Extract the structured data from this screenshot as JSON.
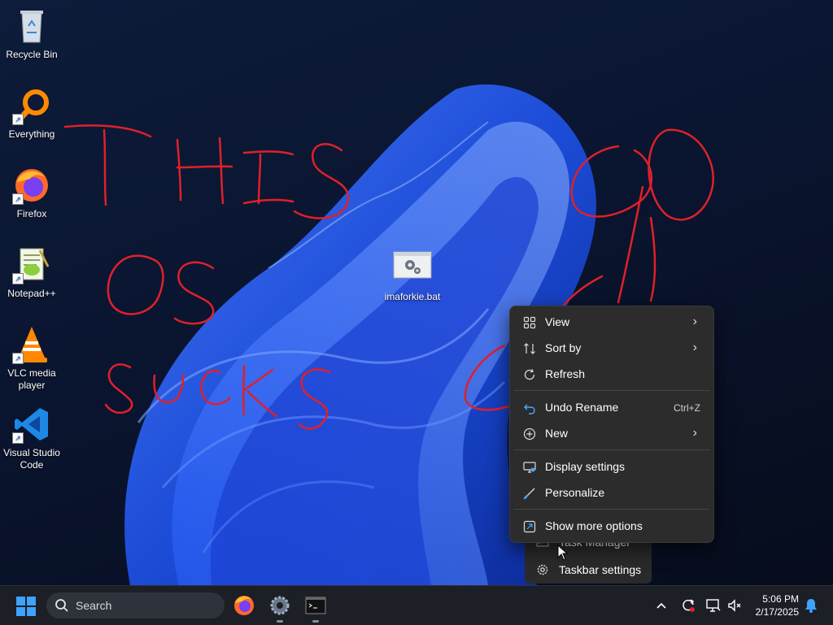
{
  "desktop": {
    "icons": [
      {
        "label": "Recycle Bin",
        "icon": "recycle-bin-icon"
      },
      {
        "label": "Everything",
        "icon": "everything-icon"
      },
      {
        "label": "Firefox",
        "icon": "firefox-icon"
      },
      {
        "label": "Notepad++",
        "icon": "notepad-plus-plus-icon"
      },
      {
        "label": "VLC media player",
        "icon": "vlc-icon"
      },
      {
        "label": "Visual Studio Code",
        "icon": "vscode-icon"
      }
    ],
    "file_icon": {
      "label": "imaforkie.bat",
      "icon": "batch-file-icon"
    },
    "scribble_text": "THIS OS SUCKS"
  },
  "context_menu": {
    "items": [
      {
        "label": "View",
        "icon": "grid-icon",
        "submenu": true
      },
      {
        "label": "Sort by",
        "icon": "sort-icon",
        "submenu": true
      },
      {
        "label": "Refresh",
        "icon": "refresh-icon"
      },
      {
        "label": "Undo Rename",
        "icon": "undo-icon",
        "shortcut": "Ctrl+Z"
      },
      {
        "label": "New",
        "icon": "plus-circle-icon",
        "submenu": true
      },
      {
        "label": "Display settings",
        "icon": "display-icon"
      },
      {
        "label": "Personalize",
        "icon": "brush-icon"
      },
      {
        "label": "Show more options",
        "icon": "expand-icon"
      }
    ]
  },
  "taskbar_menu": {
    "items": [
      {
        "label": "Task Manager",
        "icon": "task-manager-icon"
      },
      {
        "label": "Taskbar settings",
        "icon": "gear-icon"
      }
    ]
  },
  "taskbar": {
    "search_placeholder": "Search",
    "apps": [
      "firefox-icon",
      "settings-icon",
      "terminal-icon"
    ],
    "clock": {
      "time": "5:06 PM",
      "date": "2/17/2025"
    }
  },
  "colors": {
    "accent": "#0078d4",
    "scribble": "#e0202a",
    "menu_bg": "#2c2c2c"
  }
}
